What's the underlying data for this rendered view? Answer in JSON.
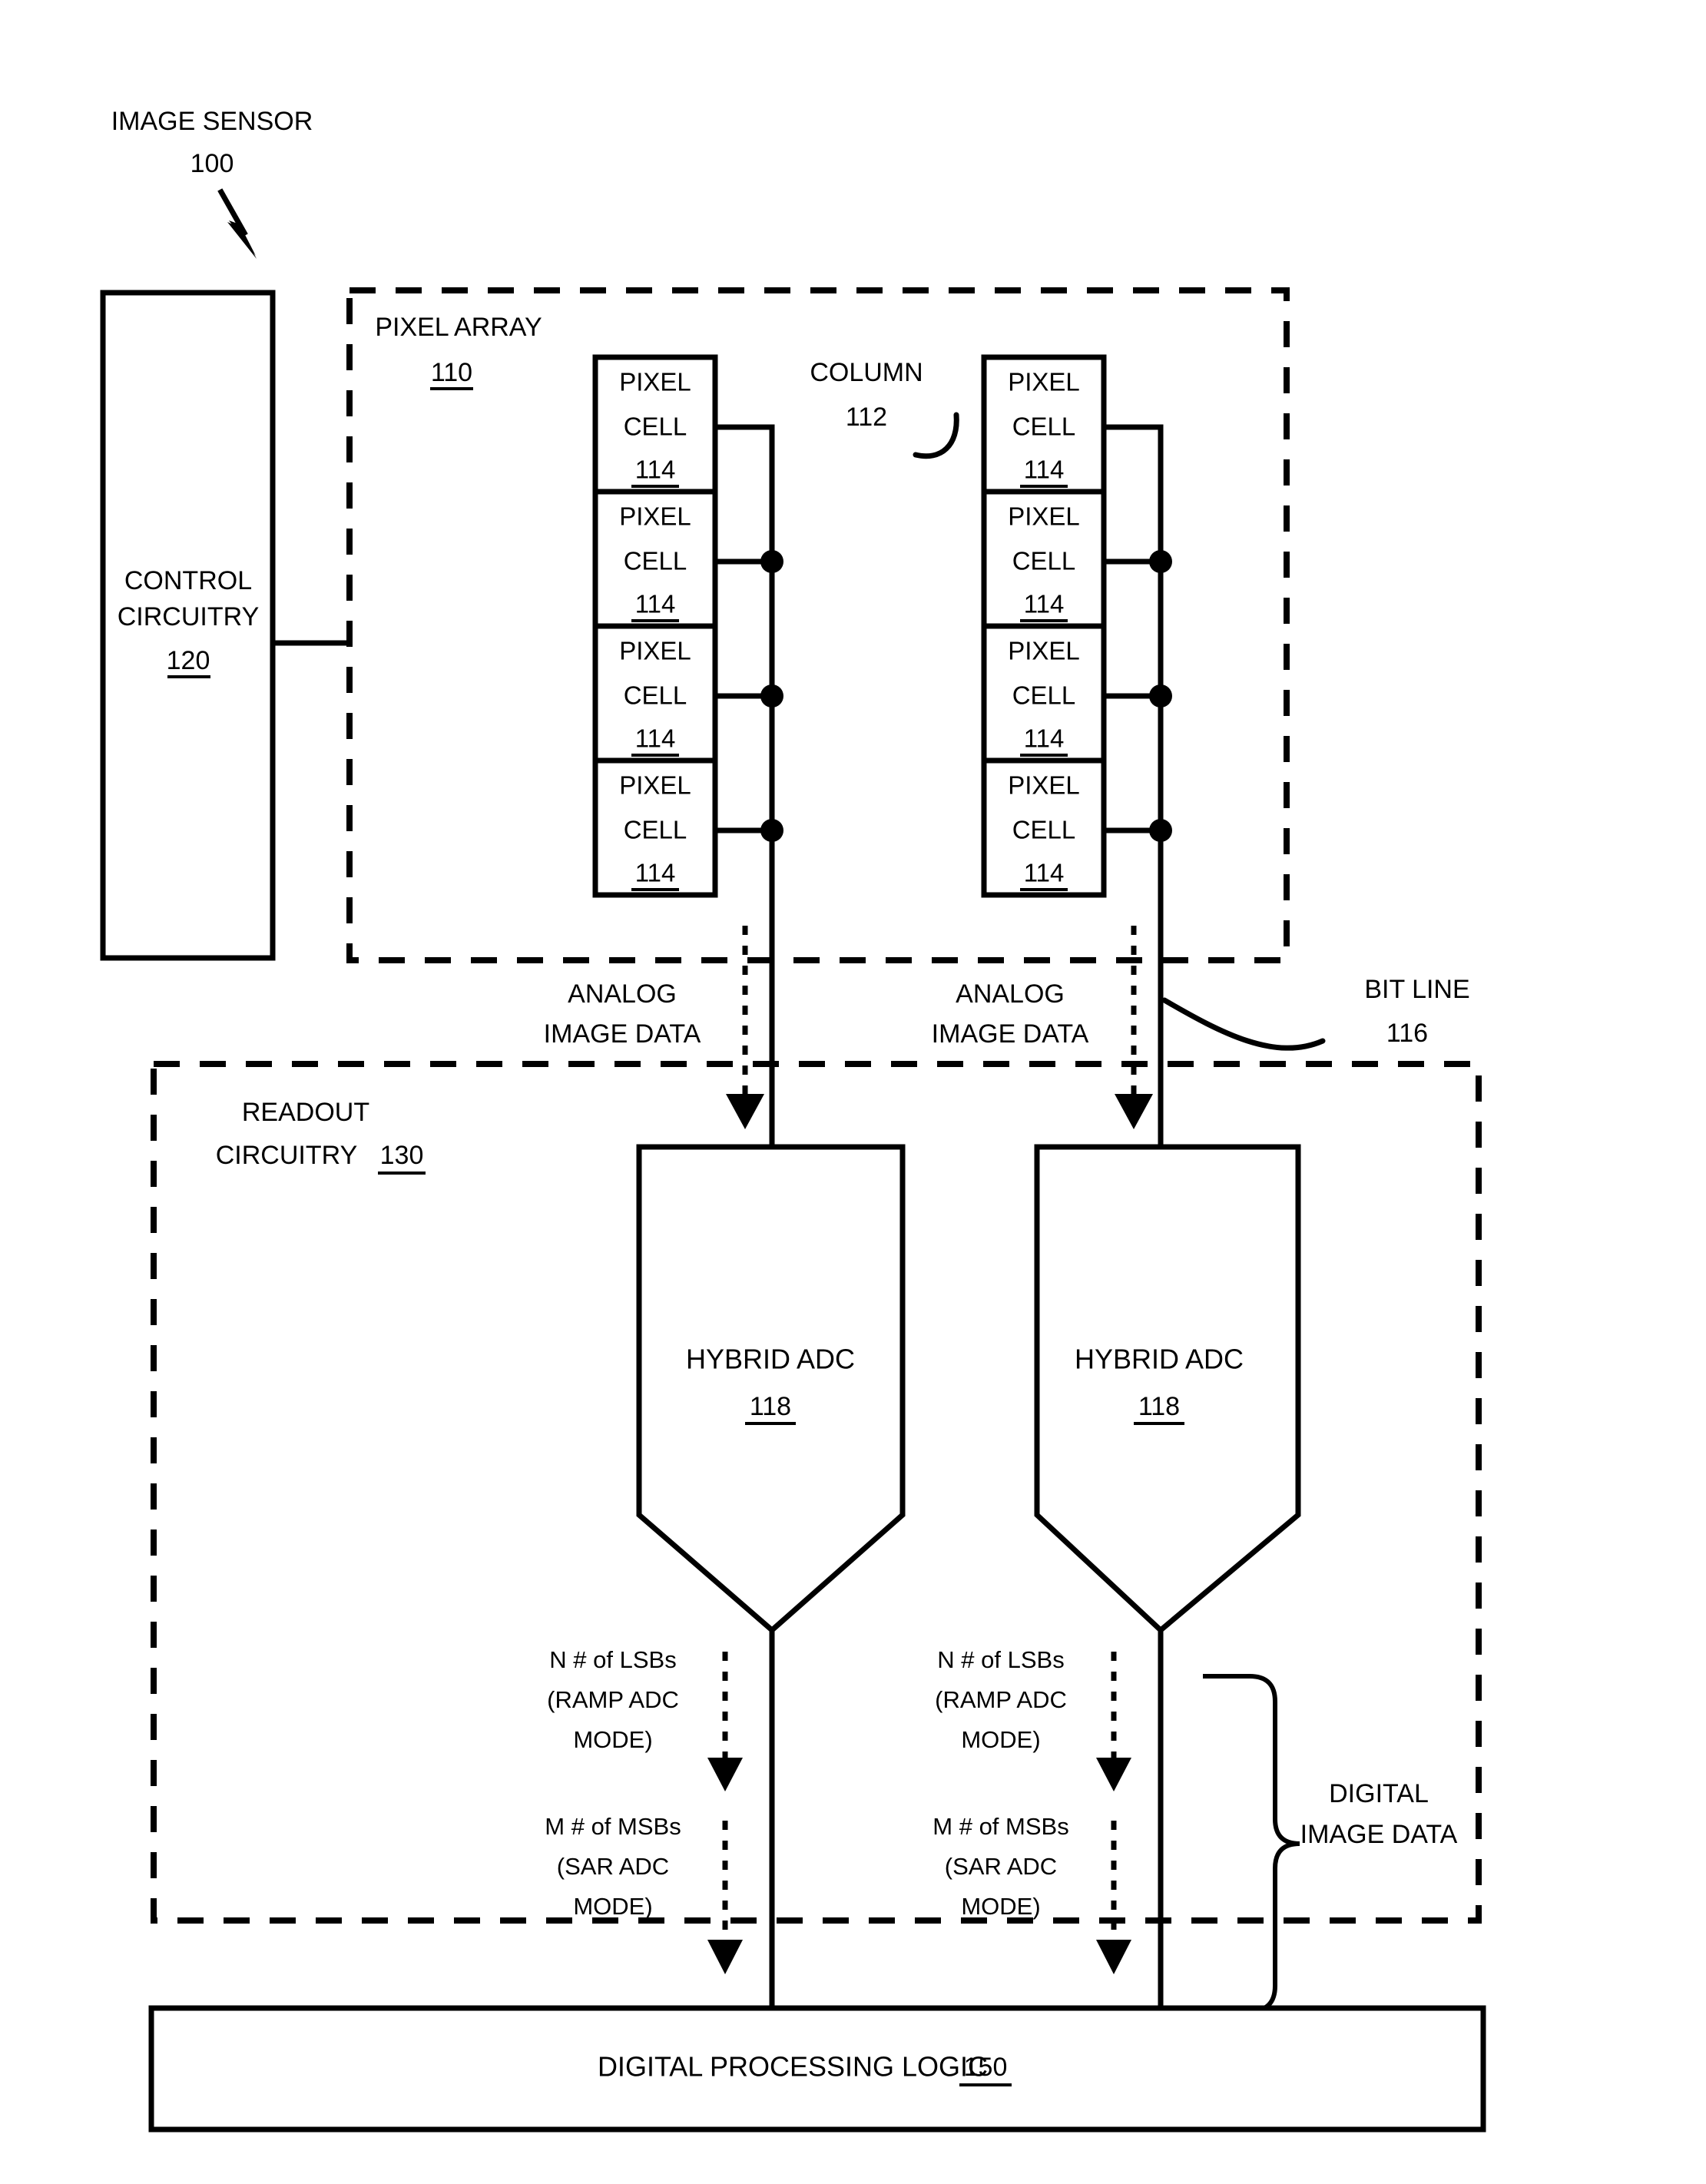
{
  "figure": {
    "title_label": "IMAGE SENSOR",
    "title_ref": "100"
  },
  "control_circuitry": {
    "line1": "CONTROL",
    "line2": "CIRCUITRY",
    "ref": "120"
  },
  "pixel_array": {
    "label": "PIXEL ARRAY",
    "ref": "110",
    "column_label": "COLUMN",
    "column_ref": "112",
    "cell_line1": "PIXEL",
    "cell_line2": "CELL",
    "cell_ref": "114",
    "columns": [
      {
        "cells": [
          {
            "line1": "PIXEL",
            "line2": "CELL",
            "ref": "114"
          },
          {
            "line1": "PIXEL",
            "line2": "CELL",
            "ref": "114"
          },
          {
            "line1": "PIXEL",
            "line2": "CELL",
            "ref": "114"
          },
          {
            "line1": "PIXEL",
            "line2": "CELL",
            "ref": "114"
          }
        ]
      },
      {
        "cells": [
          {
            "line1": "PIXEL",
            "line2": "CELL",
            "ref": "114"
          },
          {
            "line1": "PIXEL",
            "line2": "CELL",
            "ref": "114"
          },
          {
            "line1": "PIXEL",
            "line2": "CELL",
            "ref": "114"
          },
          {
            "line1": "PIXEL",
            "line2": "CELL",
            "ref": "114"
          }
        ]
      }
    ]
  },
  "signals": {
    "analog_line1": "ANALOG",
    "analog_line2": "IMAGE DATA",
    "bit_line_label": "BIT LINE",
    "bit_line_ref": "116"
  },
  "readout_circuitry": {
    "line1": "READOUT",
    "line2": "CIRCUITRY",
    "ref": "130"
  },
  "adc": {
    "label": "HYBRID ADC",
    "ref": "118",
    "instances": [
      {
        "label": "HYBRID ADC",
        "ref": "118"
      },
      {
        "label": "HYBRID ADC",
        "ref": "118"
      }
    ]
  },
  "adc_outputs": {
    "lsb_line1": "N # of LSBs",
    "lsb_line2": "(RAMP ADC",
    "lsb_line3": "MODE)",
    "msb_line1": "M # of MSBs",
    "msb_line2": "(SAR ADC",
    "msb_line3": "MODE)"
  },
  "digital_image_data": {
    "line1": "DIGITAL",
    "line2": "IMAGE DATA"
  },
  "digital_processing_logic": {
    "label": "DIGITAL PROCESSING LOGIC",
    "ref": "150"
  },
  "colors": {
    "ink": "#000000",
    "paper": "#ffffff"
  }
}
